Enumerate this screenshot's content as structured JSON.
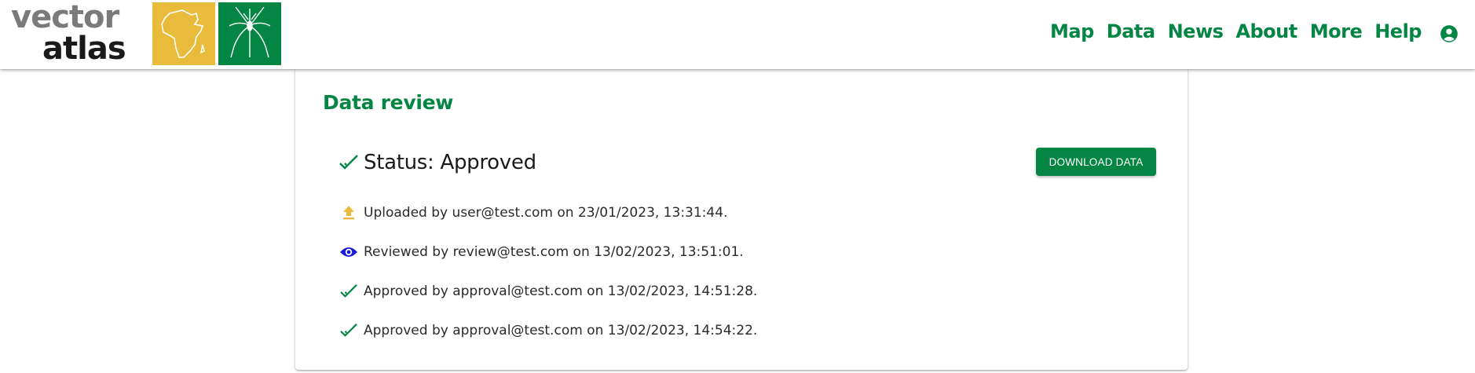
{
  "brand": {
    "line1": "vector",
    "line2": "atlas",
    "colors": {
      "green": "#038543",
      "yellow": "#e9bb3a",
      "grey": "#7a7a7a"
    }
  },
  "nav": {
    "items": [
      {
        "label": "Map"
      },
      {
        "label": "Data"
      },
      {
        "label": "News"
      },
      {
        "label": "About"
      },
      {
        "label": "More"
      },
      {
        "label": "Help"
      }
    ],
    "account_icon": "account-circle-icon"
  },
  "review": {
    "title": "Data review",
    "status_label": "Status: Approved",
    "download_label": "DOWNLOAD DATA",
    "events": [
      {
        "icon": "upload-icon",
        "text": "Uploaded by user@test.com on 23/01/2023, 13:31:44."
      },
      {
        "icon": "eye-icon",
        "text": "Reviewed by review@test.com on 13/02/2023, 13:51:01."
      },
      {
        "icon": "check-icon",
        "text": "Approved by approval@test.com on 13/02/2023, 14:51:28."
      },
      {
        "icon": "check-icon",
        "text": "Approved by approval@test.com on 13/02/2023, 14:54:22."
      }
    ]
  }
}
